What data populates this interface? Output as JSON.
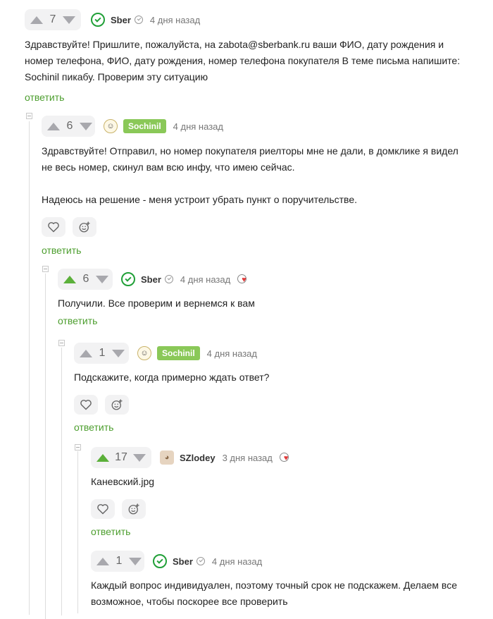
{
  "comments": [
    {
      "score": "7",
      "author": "Sber",
      "time": "4 дня назад",
      "text": [
        "Здравствуйте! Пришлите, пожалуйста, на zabota@sberbank.ru ваши ФИО, дату рождения и номер телефона, ФИО, дату рождения, номер телефона покупателя В теме письма напишите: Sochinil пикабу. Проверим эту ситуацию"
      ],
      "reply_label": "ответить"
    },
    {
      "score": "6",
      "author": "Sochinil",
      "time": "4 дня назад",
      "text": [
        "Здравствуйте! Отправил, но номер покупателя риелторы мне не дали, в домклике я видел не весь номер, скинул вам всю инфу, что имею сейчас.",
        "Надеюсь на решение - меня устроит убрать пункт о поручительстве."
      ],
      "reply_label": "ответить"
    },
    {
      "score": "6",
      "author": "Sber",
      "time": "4 дня назад",
      "text": [
        "Получили. Все проверим и вернемся к вам"
      ],
      "reply_label": "ответить"
    },
    {
      "score": "1",
      "author": "Sochinil",
      "time": "4 дня назад",
      "text": [
        "Подскажите, когда примерно ждать ответ?"
      ],
      "reply_label": "ответить"
    },
    {
      "score": "17",
      "author": "SZlodey",
      "time": "3 дня назад",
      "text": [
        "Каневский.jpg"
      ],
      "reply_label": "ответить"
    },
    {
      "score": "1",
      "author": "Sber",
      "time": "4 дня назад",
      "text": [
        "Каждый вопрос индивидуален, поэтому точный срок не подскажем. Делаем все возможное, чтобы поскорее все проверить"
      ]
    }
  ],
  "colors": {
    "accent_green": "#5bb03a",
    "link_green": "#4c9e2e",
    "tag_green": "#8ac858"
  }
}
